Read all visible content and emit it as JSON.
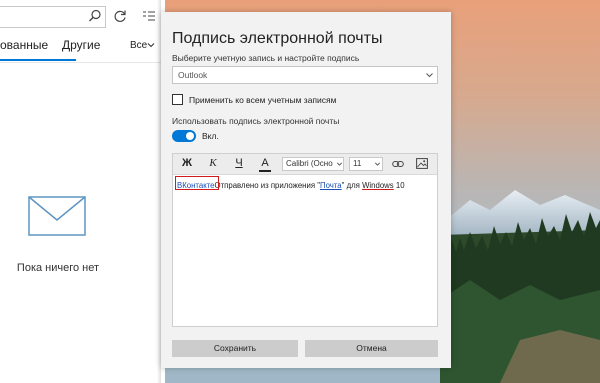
{
  "mail_panel": {
    "tabs": [
      {
        "label": "ованные"
      },
      {
        "label": "Другие"
      }
    ],
    "filter": {
      "label": "Bce"
    },
    "empty_state": {
      "text": "Пока ничего нет"
    }
  },
  "dialog": {
    "title": "Подпись электронной почты",
    "account_label": "Выберите учетную запись и настройте подпись",
    "account_value": "Outlook",
    "apply_all_label": "Применить ко всем учетным записям",
    "apply_all_checked": false,
    "use_signature_label": "Использовать подпись электронной почты",
    "toggle_state_label": "Вкл.",
    "toggle_on": true,
    "toolbar": {
      "bold": "Ж",
      "italic": "К",
      "underline": "Ч",
      "font_color": "А",
      "font_name": "Calibri (Осно",
      "font_size": "11"
    },
    "signature": {
      "link_text": "ВКонтакте",
      "text_before": "Отправлено из приложения \"",
      "app_link": "Почта",
      "text_middle": "\" для ",
      "os_word": "Windows",
      "text_after": " 10"
    },
    "save_label": "Сохранить",
    "cancel_label": "Отмена"
  },
  "colors": {
    "accent": "#0078d7",
    "highlight_border": "#d11a1a",
    "dialog_bg": "#f2f2f2",
    "button_bg": "#cccccc"
  }
}
